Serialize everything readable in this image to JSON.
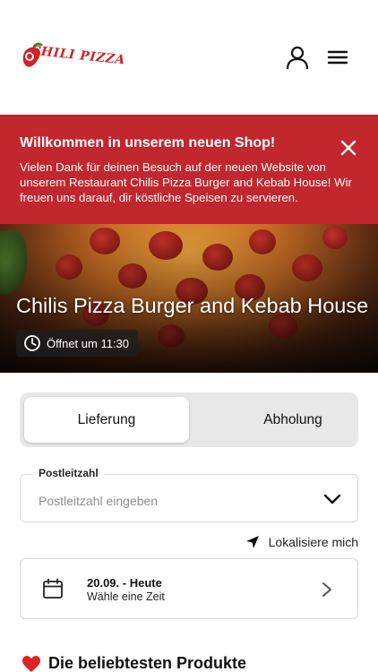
{
  "header": {
    "logo_text": "CHILI PIZZA",
    "icons": [
      "user-icon",
      "menu-icon"
    ]
  },
  "banner": {
    "title": "Willkommen in unserem neuen Shop!",
    "text": "Vielen Dank für deinen Besuch auf der neuen Website von unserem Restaurant Chilis Pizza Burger and Kebab House! Wir freuen uns darauf, dir köstliche Speisen zu servieren.",
    "background_color": "#c1272d",
    "close_icon": "close-icon"
  },
  "hero": {
    "title": "Chilis Pizza Burger and Kebab House",
    "open_status": "Öffnet um 11:30",
    "status_icon": "clock-icon"
  },
  "order_mode": {
    "options": [
      "Lieferung",
      "Abholung"
    ],
    "selected": "Lieferung"
  },
  "postcode": {
    "label": "Postleitzahl",
    "placeholder": "Postleitzahl eingeben",
    "value": ""
  },
  "localize": {
    "label": "Lokalisiere mich",
    "icon": "location-arrow-icon"
  },
  "time": {
    "date": "20.09. - Heute",
    "subtitle": "Wähle eine Zeit",
    "icon": "calendar-icon"
  },
  "popular": {
    "title": "Die beliebtesten Produkte",
    "icon": "heart-icon"
  }
}
